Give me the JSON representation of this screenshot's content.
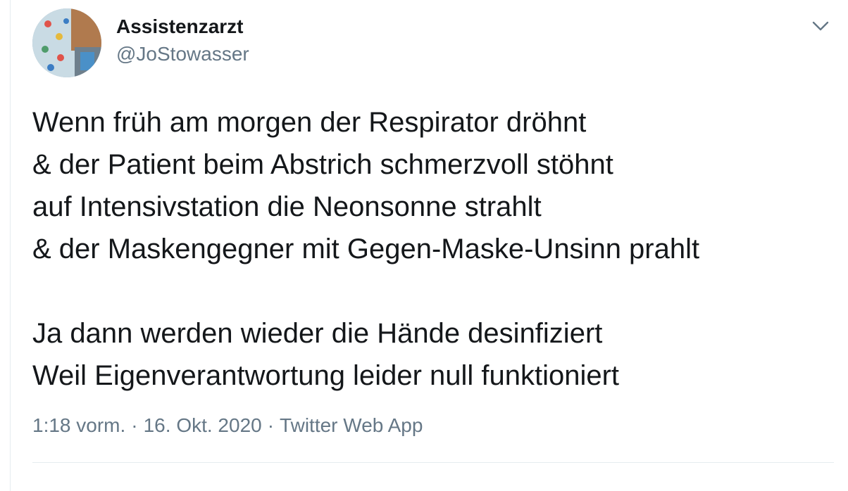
{
  "tweet": {
    "author": {
      "display_name": "Assistenzarzt",
      "handle": "@JoStowasser",
      "avatar_icon": "avatar-image"
    },
    "menu_icon": "chevron-down-icon",
    "paragraphs": [
      [
        "Wenn früh am morgen der Respirator dröhnt",
        "& der Patient beim Abstrich schmerzvoll stöhnt",
        "auf Intensivstation die Neonsonne strahlt",
        "& der Maskengegner mit Gegen-Maske-Unsinn prahlt"
      ],
      [
        "Ja dann werden wieder die Hände desinfiziert",
        "Weil Eigenverantwortung leider null funktioniert"
      ]
    ],
    "meta": {
      "time": "1:18 vorm.",
      "separator": "·",
      "date": "16. Okt. 2020",
      "source": "Twitter Web App"
    }
  },
  "colors": {
    "text_primary": "#14171a",
    "text_secondary": "#657786",
    "divider": "#e6ecf0"
  }
}
